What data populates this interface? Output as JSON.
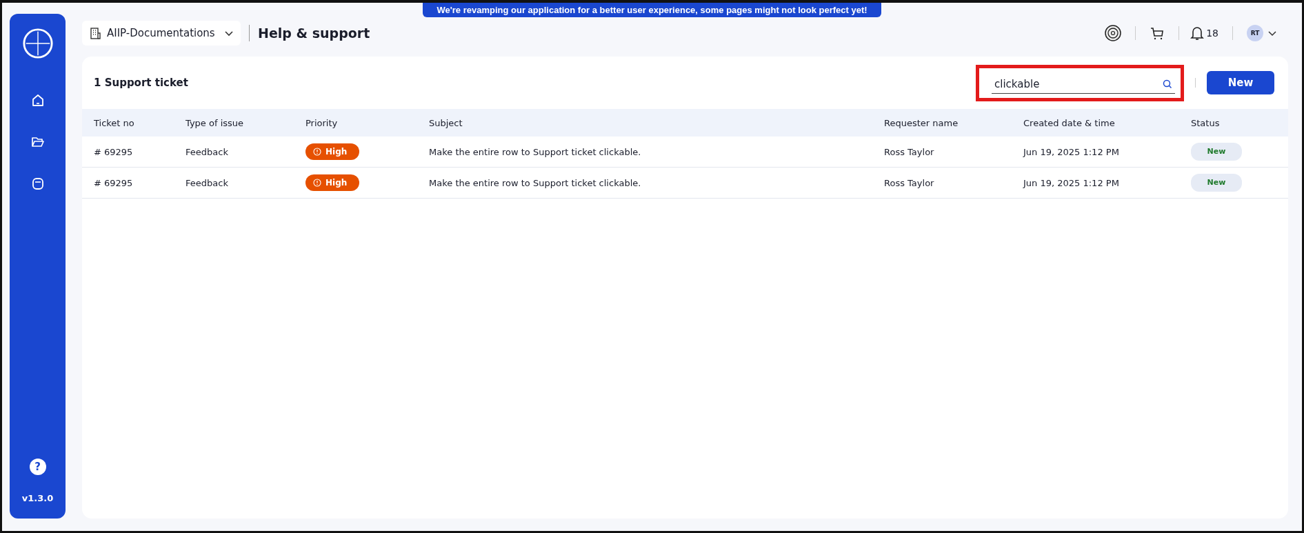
{
  "banner": "We're revamping our application for a better user experience, some pages might not look perfect yet!",
  "sidebar": {
    "version": "v1.3.0",
    "help": "?"
  },
  "header": {
    "workspace": "AIIP-Documentations",
    "title": "Help & support",
    "notifications": "18",
    "avatar": "RT"
  },
  "card": {
    "title": "1 Support ticket",
    "search": {
      "value": "clickable",
      "highlighted": true
    },
    "new_button": "New"
  },
  "table": {
    "columns": [
      "Ticket no",
      "Type of issue",
      "Priority",
      "Subject",
      "Requester name",
      "Created date & time",
      "Status"
    ],
    "rows": [
      {
        "ticket": "# 69295",
        "type": "Feedback",
        "priority": "High",
        "subject": "Make the entire row to Support ticket clickable.",
        "requester": "Ross Taylor",
        "created": "Jun 19, 2025 1:12 PM",
        "status": "New"
      },
      {
        "ticket": "# 69295",
        "type": "Feedback",
        "priority": "High",
        "subject": "Make the entire row to Support ticket clickable.",
        "requester": "Ross Taylor",
        "created": "Jun 19, 2025 1:12 PM",
        "status": "New"
      }
    ]
  }
}
